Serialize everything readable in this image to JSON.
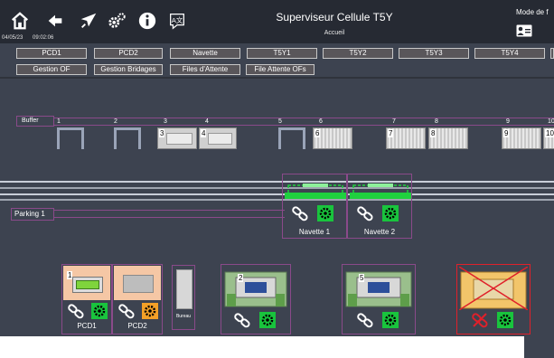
{
  "header": {
    "date": "04/05/23",
    "time": "09:02:06",
    "title": "Superviseur Cellule T5Y",
    "subtitle": "Accueil",
    "mode_label": "Mode de f",
    "icons": [
      "home-icon",
      "back-arrow-icon",
      "rocket-icon",
      "settings-gears-icon",
      "info-icon",
      "translate-icon",
      "user-card-icon"
    ]
  },
  "nav_row1": [
    "PCD1",
    "PCD2",
    "Navette",
    "T5Y1",
    "T5Y2",
    "T5Y3",
    "T5Y4",
    ""
  ],
  "nav_row2": [
    "Gestion OF",
    "Gestion Bridages",
    "Files d'Attente",
    "File Attente OFs"
  ],
  "buffer": {
    "label": "Buffer",
    "positions": [
      "1",
      "2",
      "3",
      "4",
      "5",
      "6",
      "7",
      "8",
      "9",
      "10"
    ],
    "pallets": [
      "3",
      "4",
      "6",
      "7",
      "8",
      "9",
      "10"
    ]
  },
  "parking": {
    "label": "Parking 1"
  },
  "shuttles": [
    {
      "label": "Navette 1"
    },
    {
      "label": "Navette 2"
    }
  ],
  "stations": [
    {
      "label": "PCD1",
      "pallet": "1"
    },
    {
      "label": "PCD2",
      "pallet": ""
    },
    {
      "label": "Bureau"
    },
    {
      "label": "",
      "pallet": "2"
    },
    {
      "label": "",
      "pallet": "5"
    },
    {
      "label": "",
      "pallet": ""
    }
  ],
  "colors": {
    "background": "#3d4350",
    "topbar": "#262a33",
    "accent_green": "#19c43d",
    "accent_orange": "#f3a027",
    "frame_purple": "#8a4a8a",
    "station_peach": "#f5c7a5",
    "error_red": "#e0202a"
  }
}
